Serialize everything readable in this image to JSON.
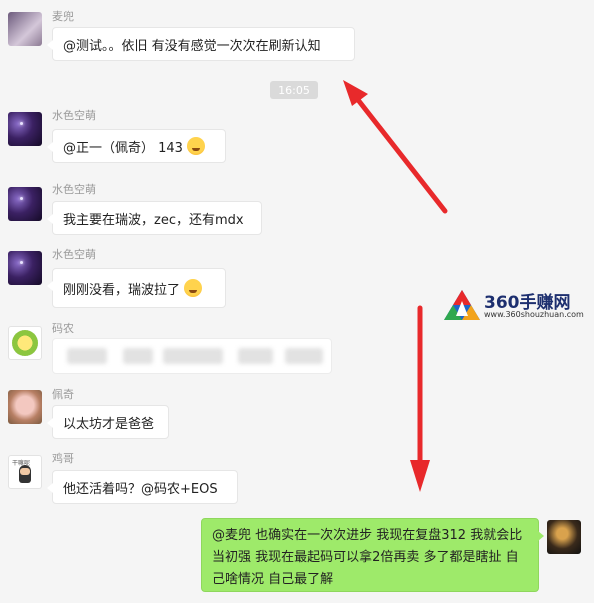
{
  "timestamp": "16:05",
  "messages": [
    {
      "sender": "麦兜",
      "text": "@测试。。依旧 有没有感觉一次次在刷新认知"
    },
    {
      "sender": "水色空萌",
      "text": "@正一（佩奇） 143",
      "emoji": "laughing-crying-emoji"
    },
    {
      "sender": "水色空萌",
      "text": "我主要在瑞波，zec，还有mdx"
    },
    {
      "sender": "水色空萌",
      "text": "刚刚没看，瑞波拉了",
      "emoji": "laughing-crying-emoji"
    },
    {
      "sender": "码农",
      "text": ""
    },
    {
      "sender": "佩奇",
      "text": "以太坊才是爸爸"
    },
    {
      "sender": "鸡哥",
      "text": "他还活着吗？@码农+EOS"
    },
    {
      "sender": "",
      "text": "@麦兜 也确实在一次次进步 我现在复盘312 我就会比当初强 我现在最起码可以拿2倍再卖 多了都是瞎扯 自己啥情况 自己最了解",
      "self": true
    }
  ],
  "watermark": {
    "title": "360手赚网",
    "url": "www.360shouzhuan.com"
  },
  "colors": {
    "background": "#f5f5f5",
    "self_bubble": "#9eea6a",
    "annotation_arrow": "#e8292b"
  }
}
